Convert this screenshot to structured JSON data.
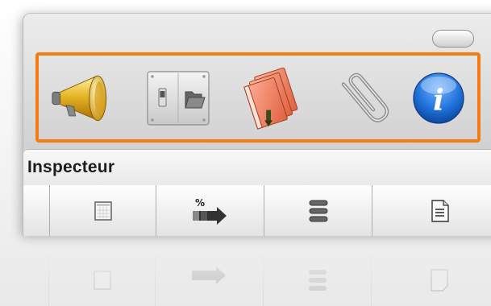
{
  "window": {
    "panel_title": "Inspecteur"
  },
  "toolbar": {
    "items": [
      {
        "icon": "megaphone-icon"
      },
      {
        "icon": "switch-folder-icon"
      },
      {
        "icon": "books-icon"
      },
      {
        "icon": "paperclip-icon"
      },
      {
        "icon": "info-icon"
      }
    ],
    "highlight_color": "#f57c12"
  },
  "tabs": [
    {
      "icon": "layout-grid-icon"
    },
    {
      "icon": "percent-arrow-icon"
    },
    {
      "icon": "stack-lines-icon"
    },
    {
      "icon": "document-icon"
    }
  ],
  "colors": {
    "accent_orange": "#f57c12",
    "info_blue": "#1e6fd9"
  }
}
